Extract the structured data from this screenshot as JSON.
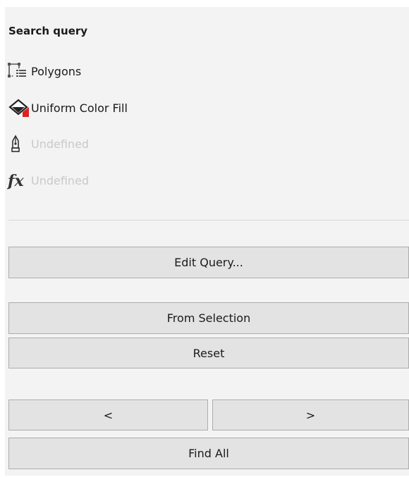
{
  "panel": {
    "title": "Search query",
    "items": [
      {
        "label": "Polygons",
        "icon": "polygons-icon",
        "enabled": true
      },
      {
        "label": "Uniform Color Fill",
        "icon": "fill-icon",
        "enabled": true
      },
      {
        "label": "Undefined",
        "icon": "pen-icon",
        "enabled": false
      },
      {
        "label": "Undefined",
        "icon": "fx-icon",
        "enabled": false
      }
    ]
  },
  "buttons": {
    "edit_query": "Edit Query...",
    "from_selection": "From Selection",
    "reset": "Reset",
    "previous": "<",
    "next": ">",
    "find_all": "Find All"
  },
  "colors": {
    "panel_bg": "#f3f3f3",
    "button_bg": "#e3e3e3",
    "button_border": "#adadad",
    "accent_red": "#e02020",
    "disabled_text": "#c9c9c9"
  }
}
